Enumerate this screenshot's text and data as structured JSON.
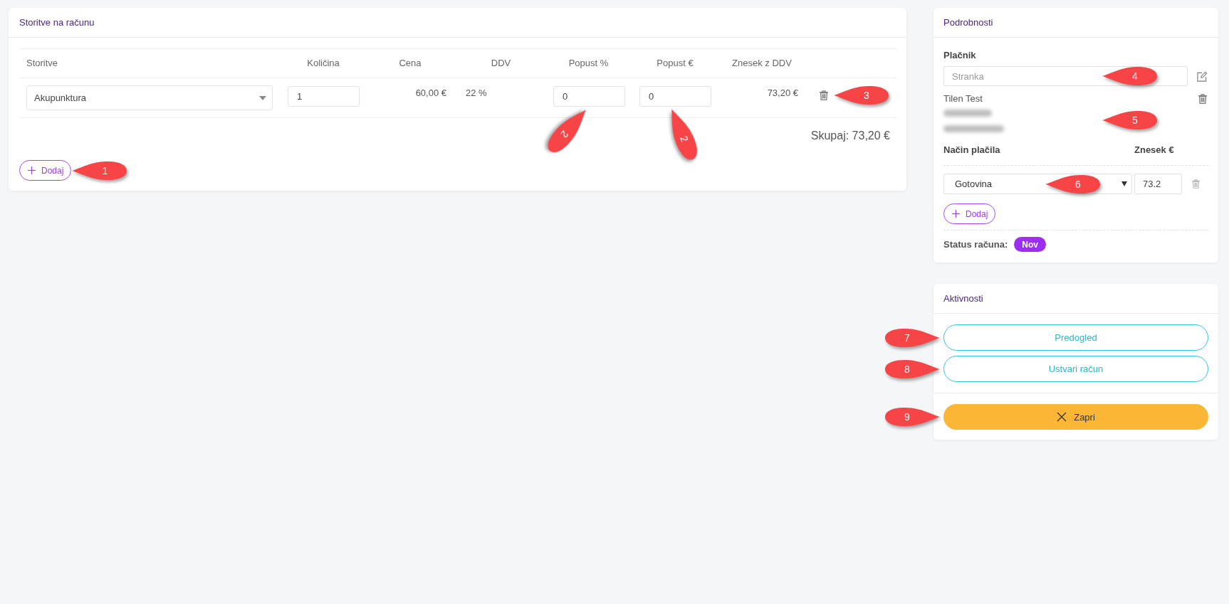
{
  "services_card": {
    "title": "Storitve na računu",
    "columns": [
      "Storitve",
      "Količina",
      "Cena",
      "DDV",
      "Popust %",
      "Popust €",
      "Znesek z DDV"
    ],
    "rows": [
      {
        "service": "Akupunktura",
        "quantity": "1",
        "price": "60,00 €",
        "vat": "22 %",
        "discount_percent": {
          "value": "0",
          "callout": "2"
        },
        "discount_amount": {
          "value": "0",
          "callout": "2"
        },
        "total": "73,20 €",
        "delete_callout": "3"
      }
    ],
    "total": "Skupaj: 73,20 €",
    "add_button": {
      "label": "Dodaj",
      "callout": "1"
    }
  },
  "details_card": {
    "title": "Podrobnosti",
    "payer_label": "Plačnik",
    "payer_field": {
      "placeholder": "Stranka",
      "callout": "4"
    },
    "client": {
      "name": "Tilen Test",
      "address_blurred": true,
      "callout": "5"
    },
    "payment_columns": [
      "Način plačila",
      "Znesek €"
    ],
    "payments": [
      {
        "method": "Gotovina",
        "amount": "73.2",
        "callout": "6"
      }
    ],
    "add_button": {
      "label": "Dodaj"
    },
    "status": {
      "label": "Status računa:",
      "badge": "Nov"
    }
  },
  "activities_card": {
    "title": "Aktivnosti",
    "buttons": [
      {
        "label": "Predogled",
        "callout": "7"
      },
      {
        "label": "Ustvari račun",
        "callout": "8"
      }
    ],
    "close_button": {
      "label": "Zapri",
      "callout": "9"
    }
  }
}
